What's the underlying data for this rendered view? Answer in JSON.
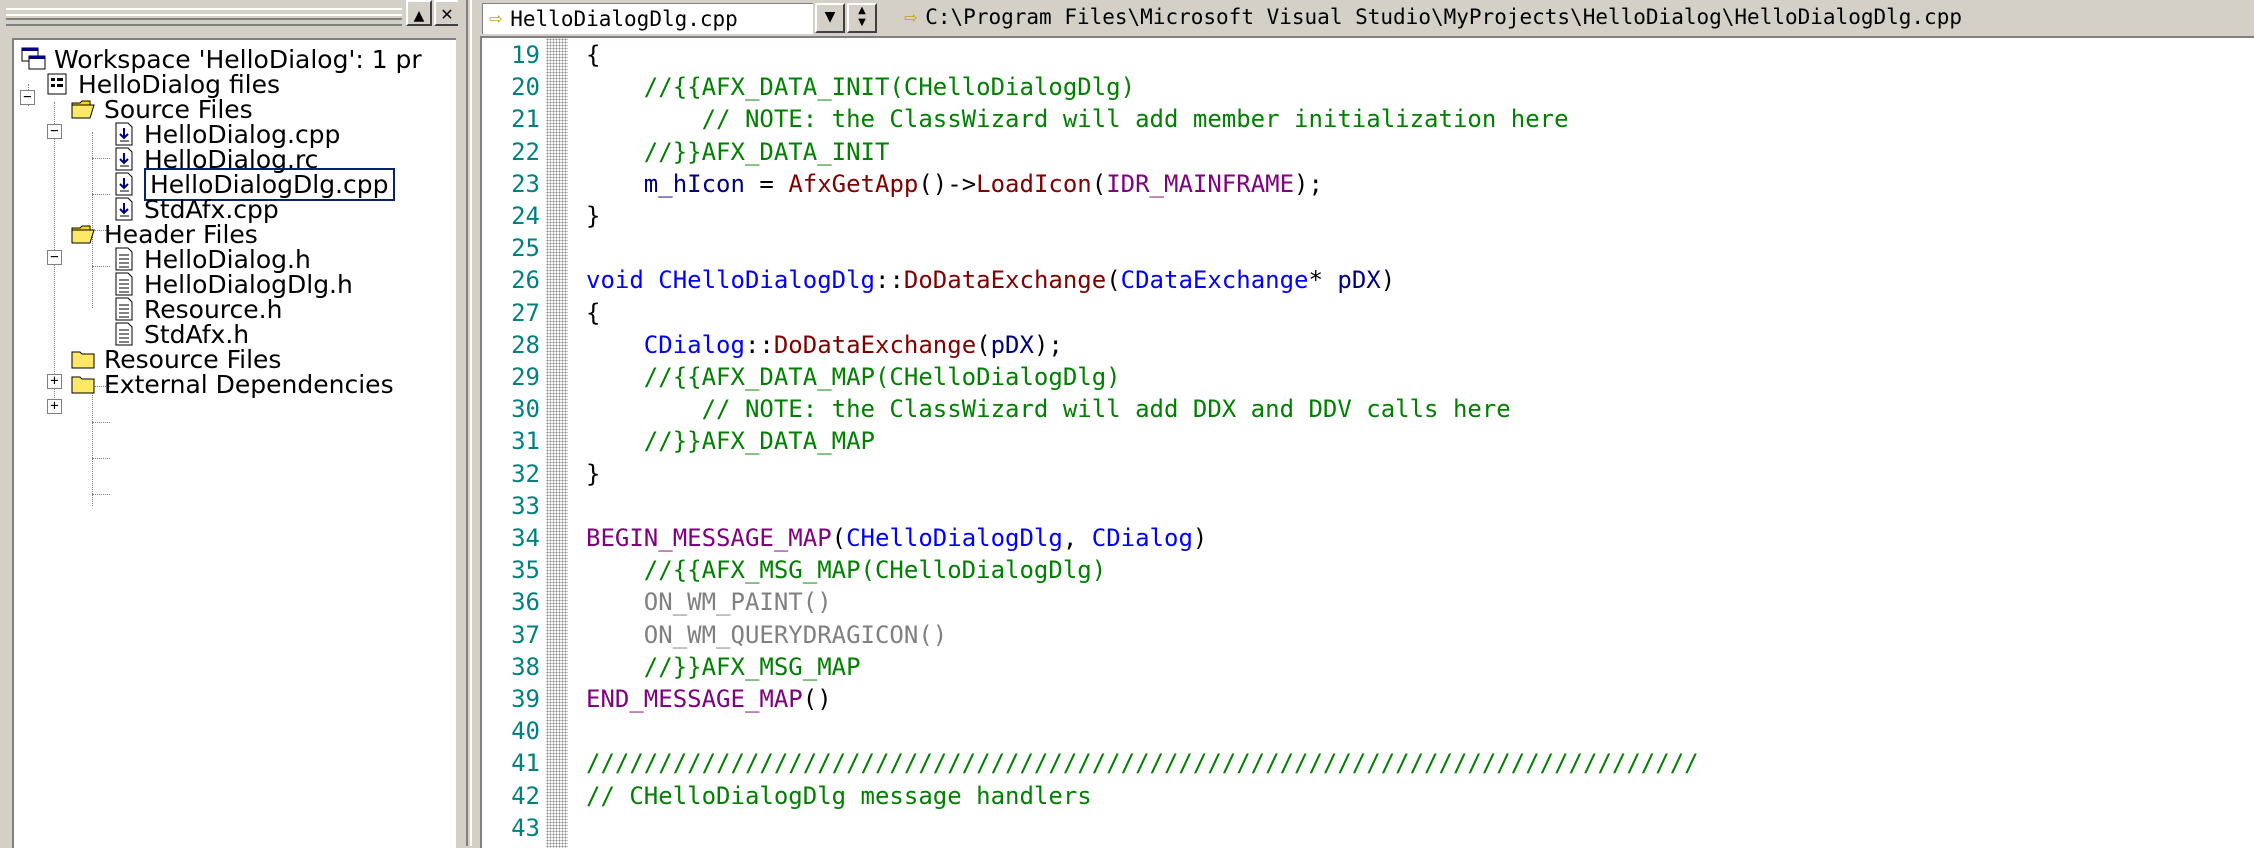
{
  "workspace": {
    "title": "Workspace 'HelloDialog': 1 pr",
    "min_button": "▲",
    "close_button": "✕",
    "project": "HelloDialog files",
    "folders": [
      {
        "label": "Source Files",
        "expanded": true,
        "files": [
          "HelloDialog.cpp",
          "HelloDialog.rc",
          "HelloDialogDlg.cpp",
          "StdAfx.cpp"
        ]
      },
      {
        "label": "Header Files",
        "expanded": true,
        "files": [
          "HelloDialog.h",
          "HelloDialogDlg.h",
          "Resource.h",
          "StdAfx.h"
        ]
      },
      {
        "label": "Resource Files",
        "expanded": false
      },
      {
        "label": "External Dependencies",
        "expanded": false
      }
    ],
    "selected_file": "HelloDialogDlg.cpp",
    "minus": "−",
    "plus": "+"
  },
  "editor": {
    "file_combo_value": "HelloDialogDlg.cpp",
    "path": "C:\\Program Files\\Microsoft Visual Studio\\MyProjects\\HelloDialog\\HelloDialogDlg.cpp",
    "arrow_glyph": "⇨",
    "lines": [
      {
        "n": "19",
        "tokens": [
          {
            "t": "{",
            "c": "plain"
          }
        ]
      },
      {
        "n": "20",
        "tokens": [
          {
            "t": "    //{{AFX_DATA_INIT(CHelloDialogDlg)",
            "c": "comment"
          }
        ]
      },
      {
        "n": "21",
        "tokens": [
          {
            "t": "        // NOTE: the ClassWizard will add member initialization here",
            "c": "comment"
          }
        ]
      },
      {
        "n": "22",
        "tokens": [
          {
            "t": "    //}}AFX_DATA_INIT",
            "c": "comment"
          }
        ]
      },
      {
        "n": "23",
        "tokens": [
          {
            "t": "    m_hIcon",
            "c": "member"
          },
          {
            "t": " = ",
            "c": "plain"
          },
          {
            "t": "AfxGetApp",
            "c": "func"
          },
          {
            "t": "()->",
            "c": "plain"
          },
          {
            "t": "LoadIcon",
            "c": "func"
          },
          {
            "t": "(",
            "c": "plain"
          },
          {
            "t": "IDR_MAINFRAME",
            "c": "macro"
          },
          {
            "t": ");",
            "c": "plain"
          }
        ]
      },
      {
        "n": "24",
        "tokens": [
          {
            "t": "}",
            "c": "plain"
          }
        ]
      },
      {
        "n": "25",
        "tokens": []
      },
      {
        "n": "26",
        "tokens": [
          {
            "t": "void",
            "c": "keyword"
          },
          {
            "t": " ",
            "c": "plain"
          },
          {
            "t": "CHelloDialogDlg",
            "c": "class"
          },
          {
            "t": "::",
            "c": "plain"
          },
          {
            "t": "DoDataExchange",
            "c": "func"
          },
          {
            "t": "(",
            "c": "plain"
          },
          {
            "t": "CDataExchange",
            "c": "class"
          },
          {
            "t": "* ",
            "c": "plain"
          },
          {
            "t": "pDX",
            "c": "member"
          },
          {
            "t": ")",
            "c": "plain"
          }
        ]
      },
      {
        "n": "27",
        "tokens": [
          {
            "t": "{",
            "c": "plain"
          }
        ]
      },
      {
        "n": "28",
        "tokens": [
          {
            "t": "    ",
            "c": "plain"
          },
          {
            "t": "CDialog",
            "c": "class"
          },
          {
            "t": "::",
            "c": "plain"
          },
          {
            "t": "DoDataExchange",
            "c": "func"
          },
          {
            "t": "(",
            "c": "plain"
          },
          {
            "t": "pDX",
            "c": "member"
          },
          {
            "t": ");",
            "c": "plain"
          }
        ]
      },
      {
        "n": "29",
        "tokens": [
          {
            "t": "    //{{AFX_DATA_MAP(CHelloDialogDlg)",
            "c": "comment"
          }
        ]
      },
      {
        "n": "30",
        "tokens": [
          {
            "t": "        // NOTE: the ClassWizard will add DDX and DDV calls here",
            "c": "comment"
          }
        ]
      },
      {
        "n": "31",
        "tokens": [
          {
            "t": "    //}}AFX_DATA_MAP",
            "c": "comment"
          }
        ]
      },
      {
        "n": "32",
        "tokens": [
          {
            "t": "}",
            "c": "plain"
          }
        ]
      },
      {
        "n": "33",
        "tokens": []
      },
      {
        "n": "34",
        "tokens": [
          {
            "t": "BEGIN_MESSAGE_MAP",
            "c": "macro"
          },
          {
            "t": "(",
            "c": "plain"
          },
          {
            "t": "CHelloDialogDlg",
            "c": "class"
          },
          {
            "t": ", ",
            "c": "plain"
          },
          {
            "t": "CDialog",
            "c": "class"
          },
          {
            "t": ")",
            "c": "plain"
          }
        ]
      },
      {
        "n": "35",
        "tokens": [
          {
            "t": "    //{{AFX_MSG_MAP(CHelloDialogDlg)",
            "c": "comment"
          }
        ]
      },
      {
        "n": "36",
        "tokens": [
          {
            "t": "    ON_WM_PAINT()",
            "c": "gray"
          }
        ]
      },
      {
        "n": "37",
        "tokens": [
          {
            "t": "    ON_WM_QUERYDRAGICON()",
            "c": "gray"
          }
        ]
      },
      {
        "n": "38",
        "tokens": [
          {
            "t": "    //}}AFX_MSG_MAP",
            "c": "comment"
          }
        ]
      },
      {
        "n": "39",
        "tokens": [
          {
            "t": "END_MESSAGE_MAP",
            "c": "macro"
          },
          {
            "t": "()",
            "c": "plain"
          }
        ]
      },
      {
        "n": "40",
        "tokens": []
      },
      {
        "n": "41",
        "tokens": [
          {
            "t": "/////////////////////////////////////////////////////////////////////////////",
            "c": "comment"
          }
        ]
      },
      {
        "n": "42",
        "tokens": [
          {
            "t": "// CHelloDialogDlg message handlers",
            "c": "comment"
          }
        ]
      },
      {
        "n": "43",
        "tokens": []
      }
    ]
  }
}
